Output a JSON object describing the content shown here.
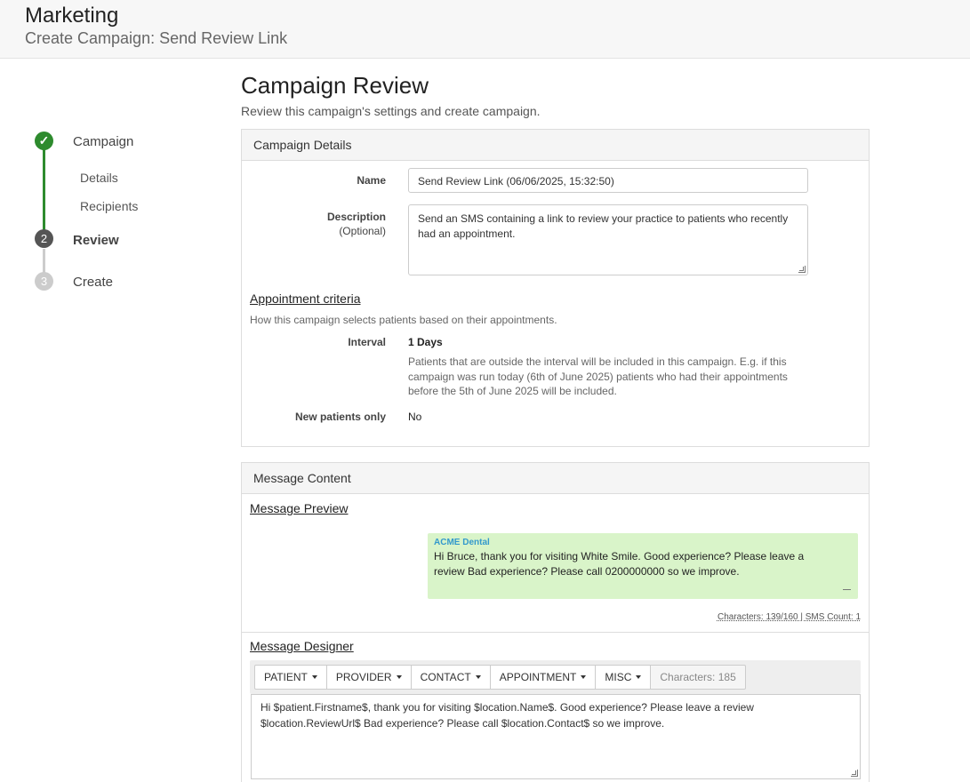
{
  "header": {
    "title": "Marketing",
    "subtitle": "Create Campaign: Send Review Link"
  },
  "stepper": {
    "step1": {
      "label": "Campaign",
      "marker": "✓"
    },
    "substeps": [
      "Details",
      "Recipients"
    ],
    "step2": {
      "label": "Review",
      "marker": "2"
    },
    "step3": {
      "label": "Create",
      "marker": "3"
    }
  },
  "page": {
    "title": "Campaign Review",
    "description": "Review this campaign's settings and create campaign."
  },
  "details": {
    "heading": "Campaign Details",
    "name_label": "Name",
    "name_value": "Send Review Link (06/06/2025, 15:32:50)",
    "desc_label": "Description",
    "desc_optional": "(Optional)",
    "desc_value": "Send an SMS containing a link to review your practice to patients who recently had an appointment.",
    "criteria_heading": "Appointment criteria",
    "criteria_desc": "How this campaign selects patients based on their appointments.",
    "interval_label": "Interval",
    "interval_value": "1 Days",
    "interval_help": "Patients that are outside the interval will be included in this campaign. E.g. if this campaign was run today (6th of June 2025) patients who had their appointments before the 5th of June 2025 will be included.",
    "new_patients_label": "New patients only",
    "new_patients_value": "No"
  },
  "message": {
    "heading": "Message Content",
    "preview_heading": "Message Preview",
    "sender": "ACME Dental",
    "preview_text": "Hi Bruce, thank you for visiting White Smile. Good experience? Please leave a review Bad experience? Please call 0200000000 so we improve.",
    "char_info": "Characters: 139/160 | SMS Count: 1",
    "designer_heading": "Message Designer",
    "toolbar": [
      "PATIENT",
      "PROVIDER",
      "CONTACT",
      "APPOINTMENT",
      "MISC"
    ],
    "toolbar_chars": "Characters: 185",
    "designer_text": "Hi $patient.Firstname$, thank you for visiting $location.Name$. Good experience? Please leave a review $location.ReviewUrl$ Bad experience? Please call $location.Contact$ so we improve."
  },
  "colors": {
    "success": "#2e8b2e",
    "bubble": "#d9f4c9",
    "sender": "#3399cc"
  }
}
